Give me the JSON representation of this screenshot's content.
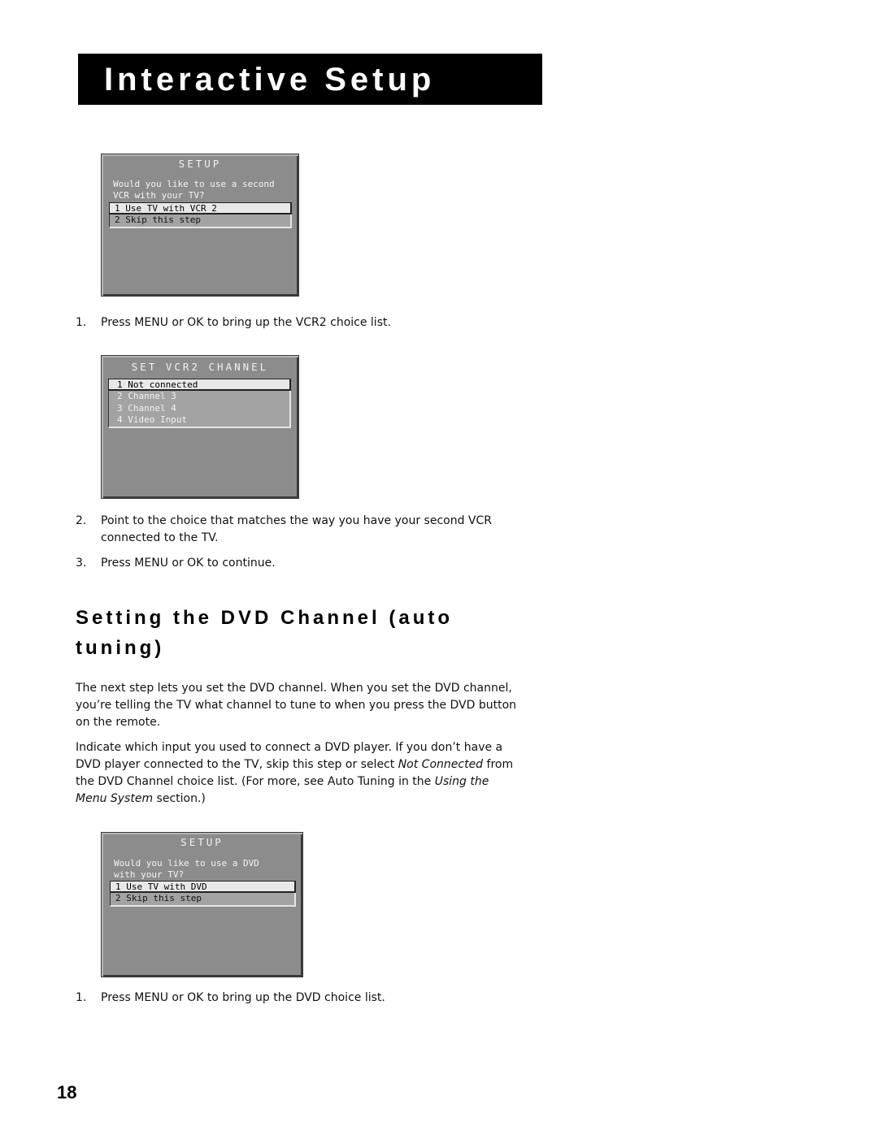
{
  "header": {
    "title": "Interactive Setup"
  },
  "screens": {
    "vcr2_setup": {
      "title": "SETUP",
      "prompt": "Would you like to use a second\nVCR with your TV?",
      "options": [
        "1 Use TV with VCR 2",
        "2 Skip this step"
      ],
      "selected_index": 0
    },
    "vcr2_channel": {
      "title": "SET VCR2 CHANNEL",
      "options": [
        "1 Not connected",
        "2 Channel 3",
        "3 Channel 4",
        "4 Video Input"
      ],
      "selected_index": 0
    },
    "dvd_setup": {
      "title": "SETUP",
      "prompt": "Would you like to use a DVD\nwith your TV?",
      "options": [
        "1 Use TV with DVD",
        "2 Skip this step"
      ],
      "selected_index": 0
    }
  },
  "steps_vcr2_a": [
    {
      "num": "1.",
      "text": "Press MENU or OK to bring up the VCR2 choice list."
    }
  ],
  "steps_vcr2_b": [
    {
      "num": "2.",
      "text": "Point to the choice that matches the way you have your second VCR connected to the TV."
    },
    {
      "num": "3.",
      "text": "Press MENU or OK to continue."
    }
  ],
  "section": {
    "heading": "Setting the DVD Channel (auto tuning)",
    "para1": "The next step lets you set the DVD channel. When you set the DVD channel, you’re telling the TV what channel to tune to when you press the DVD button on the remote.",
    "para2_part1": "Indicate which input you used to connect a DVD player. If you don’t have a DVD player connected to the TV, skip this step or select ",
    "para2_italic1": "Not Connected",
    "para2_part2": " from the DVD Channel choice list. (For more, see Auto Tuning in the ",
    "para2_italic2": "Using the Menu System",
    "para2_part3": " section.)"
  },
  "steps_dvd": [
    {
      "num": "1.",
      "text": "Press MENU or OK to bring up the DVD choice list."
    }
  ],
  "footer": {
    "page_number": "18"
  }
}
